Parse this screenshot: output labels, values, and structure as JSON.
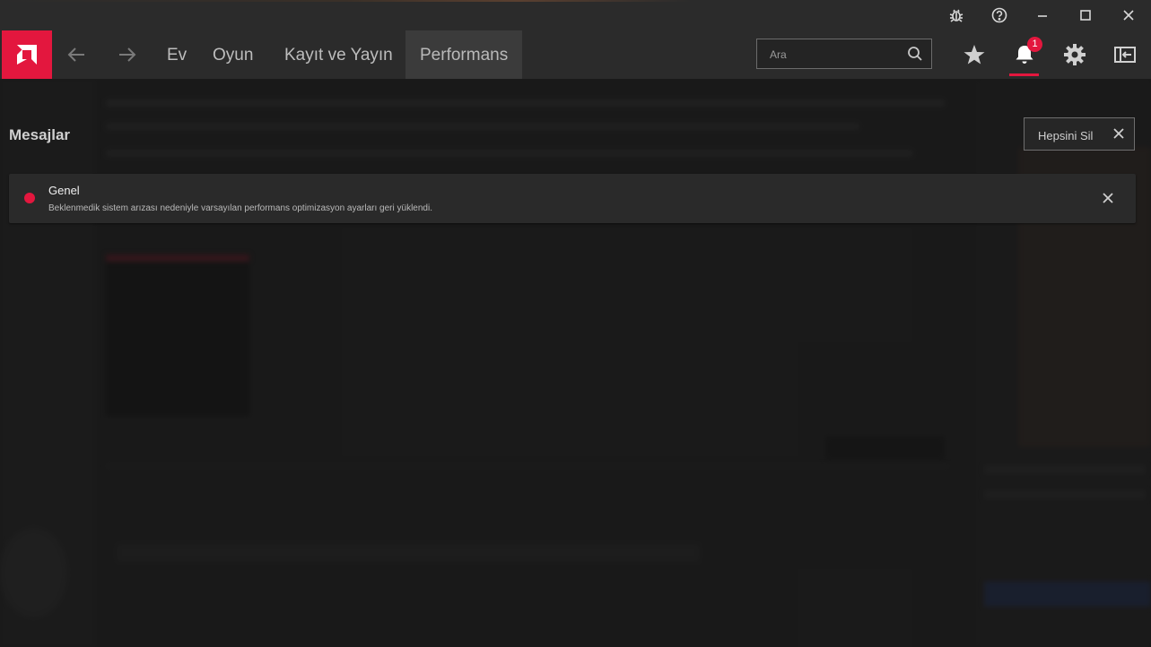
{
  "header": {
    "nav_items": [
      "Ev",
      "Oyun",
      "Kayıt ve Yayın",
      "Performans"
    ],
    "active_tab": "Performans",
    "search": {
      "placeholder": "Ara"
    },
    "notification_count": "1"
  },
  "messages": {
    "title": "Mesajlar",
    "clear_all_label": "Hepsini Sil",
    "items": [
      {
        "title": "Genel",
        "body": "Beklenmedik sistem arızası nedeniyle varsayılan performans optimizasyon ayarları geri yüklendi."
      }
    ]
  },
  "colors": {
    "accent": "#e3173e",
    "nav_background": "#2b2b2b",
    "active_tab_background": "#3b3b3b"
  },
  "icons": [
    "bug-icon",
    "help-icon",
    "minimize-icon",
    "maximize-icon",
    "close-icon",
    "amd-logo-icon",
    "back-arrow-icon",
    "forward-arrow-icon",
    "search-icon",
    "star-icon",
    "bell-icon",
    "gear-icon",
    "sidebar-toggle-icon"
  ]
}
